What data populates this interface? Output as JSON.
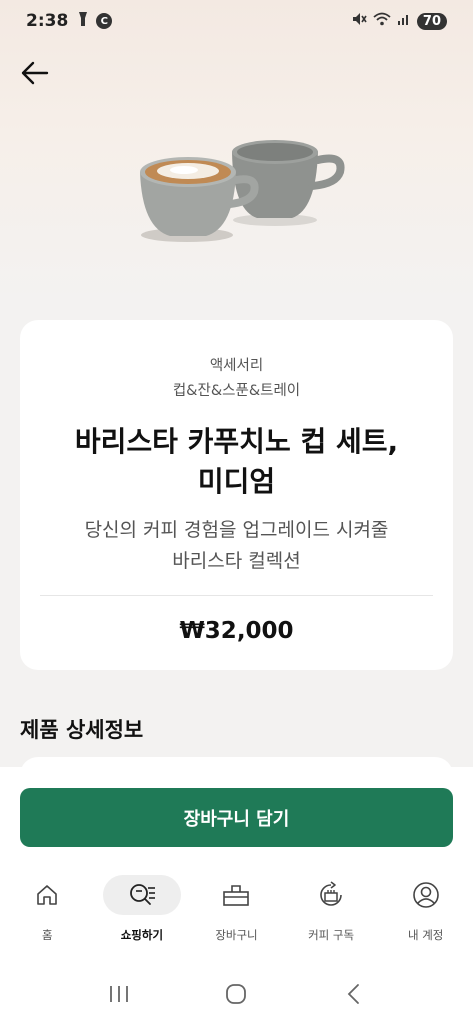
{
  "status_bar": {
    "time": "2:38",
    "battery": "70",
    "left_icons": [
      "flashlight-icon",
      "c-circle-icon"
    ],
    "right_icons": [
      "mute-icon",
      "wifi-icon",
      "signal-icon"
    ]
  },
  "product": {
    "category_primary": "액세서리",
    "category_secondary": "컵&잔&스푼&트레이",
    "title_line1": "바리스타 카푸치노 컵 세트,",
    "title_line2": "미디엄",
    "desc_line1": "당신의 커피 경험을 업그레이드 시켜줄",
    "desc_line2": "바리스타 컬렉션",
    "price": "₩32,000"
  },
  "details": {
    "heading": "제품 상세정보"
  },
  "actions": {
    "add_to_cart": "장바구니 담기"
  },
  "bottom_nav": {
    "items": [
      {
        "label": "홈",
        "icon": "home-icon",
        "active": false
      },
      {
        "label": "쇼핑하기",
        "icon": "shopping-search-icon",
        "active": true
      },
      {
        "label": "장바구니",
        "icon": "cart-bag-icon",
        "active": false
      },
      {
        "label": "커피 구독",
        "icon": "coffee-subscription-icon",
        "active": false
      },
      {
        "label": "내 계정",
        "icon": "account-icon",
        "active": false
      }
    ]
  },
  "colors": {
    "accent": "#1f7a57",
    "background": "#f3f2f1",
    "card": "#ffffff"
  }
}
